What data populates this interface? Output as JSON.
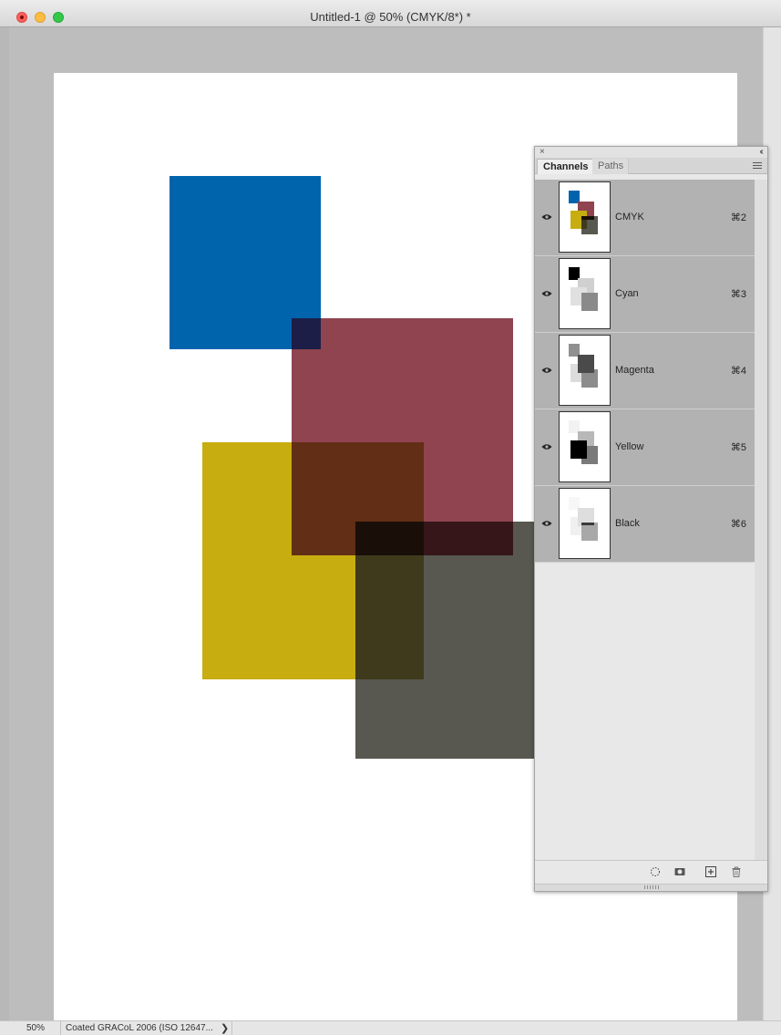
{
  "window": {
    "title": "Untitled-1 @ 50% (CMYK/8*) *"
  },
  "status": {
    "zoom": "50%",
    "profile": "Coated GRACoL 2006 (ISO 12647...",
    "arrow": "❯"
  },
  "canvas_swatches": [
    {
      "name": "cyan-square",
      "color": "#0064ad"
    },
    {
      "name": "magenta-square",
      "color": "#8f4450"
    },
    {
      "name": "yellow-square",
      "color": "#c7ad10"
    },
    {
      "name": "black-square",
      "color": "#585850"
    },
    {
      "name": "overlap-cyan-magenta",
      "color": "#1c1e47"
    },
    {
      "name": "overlap-magenta-yellow",
      "color": "#622e15"
    },
    {
      "name": "overlap-yellow-black",
      "color": "#3f3a1c"
    },
    {
      "name": "overlap-magenta-black",
      "color": "#361618"
    },
    {
      "name": "overlap-all",
      "color": "#190f08"
    }
  ],
  "panel": {
    "close": "×",
    "collapse": "‹‹",
    "tabs": [
      {
        "label": "Channels",
        "active": true
      },
      {
        "label": "Paths",
        "active": false
      }
    ],
    "channels": [
      {
        "name": "CMYK",
        "shortcut": "⌘2"
      },
      {
        "name": "Cyan",
        "shortcut": "⌘3"
      },
      {
        "name": "Magenta",
        "shortcut": "⌘4"
      },
      {
        "name": "Yellow",
        "shortcut": "⌘5"
      },
      {
        "name": "Black",
        "shortcut": "⌘6"
      }
    ],
    "footer_icons": [
      "load-selection-icon",
      "save-selection-icon",
      "new-channel-icon",
      "delete-channel-icon"
    ]
  }
}
